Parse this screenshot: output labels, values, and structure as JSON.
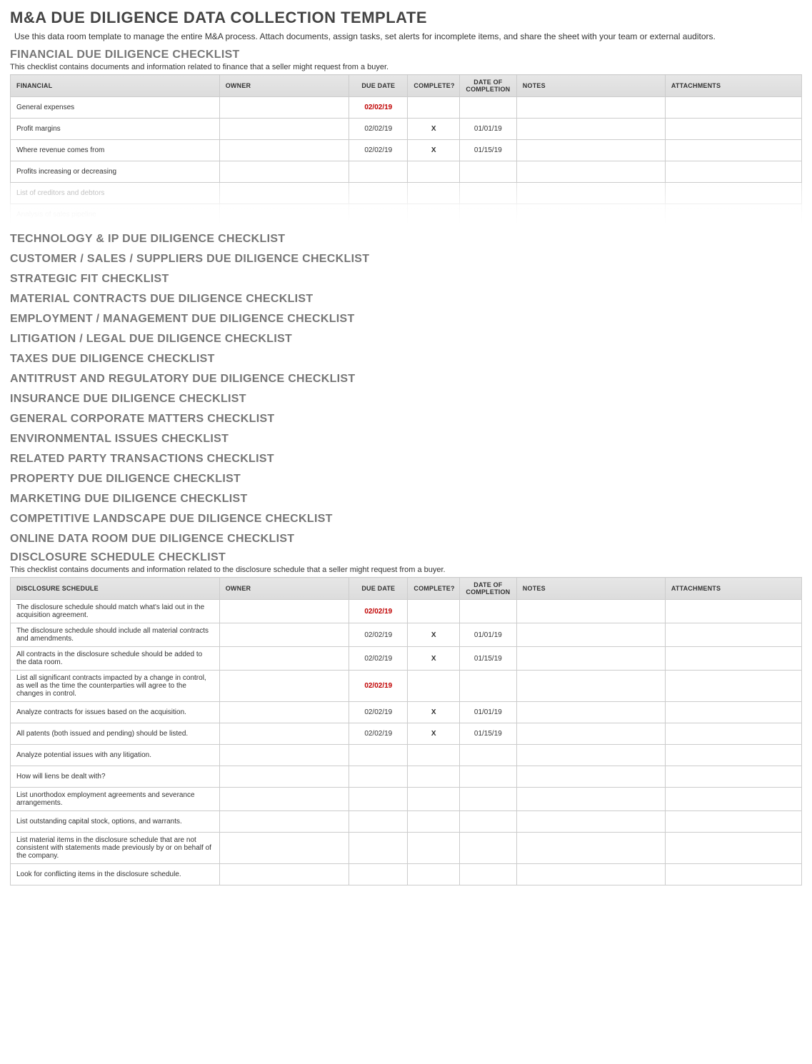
{
  "title": "M&A DUE DILIGENCE DATA COLLECTION TEMPLATE",
  "intro": "Use this data room template to manage the entire M&A process. Attach documents, assign tasks, set alerts for incomplete items, and share the sheet with your team or external auditors.",
  "financial": {
    "heading": "FINANCIAL DUE DILIGENCE CHECKLIST",
    "desc": "This checklist contains documents and information related to finance that a seller might request from a buyer.",
    "col_header": "FINANCIAL",
    "rows": [
      {
        "item": "General expenses",
        "owner": "",
        "due": "02/02/19",
        "due_overdue": true,
        "complete": "",
        "completion": "",
        "notes": "",
        "attach": ""
      },
      {
        "item": "Profit margins",
        "owner": "",
        "due": "02/02/19",
        "due_overdue": false,
        "complete": "X",
        "completion": "01/01/19",
        "notes": "",
        "attach": ""
      },
      {
        "item": "Where revenue comes from",
        "owner": "",
        "due": "02/02/19",
        "due_overdue": false,
        "complete": "X",
        "completion": "01/15/19",
        "notes": "",
        "attach": ""
      },
      {
        "item": "Profits increasing or decreasing",
        "owner": "",
        "due": "",
        "due_overdue": false,
        "complete": "",
        "completion": "",
        "notes": "",
        "attach": ""
      },
      {
        "item": "List of creditors and debtors",
        "owner": "",
        "due": "",
        "due_overdue": false,
        "complete": "",
        "completion": "",
        "notes": "",
        "attach": "",
        "fade": true
      },
      {
        "item": "Analysis of sales pipeline",
        "owner": "",
        "due": "",
        "due_overdue": false,
        "complete": "",
        "completion": "",
        "notes": "",
        "attach": "",
        "fade2": true
      }
    ]
  },
  "columns": {
    "owner": "OWNER",
    "due": "DUE DATE",
    "complete": "COMPLETE?",
    "completion": "DATE OF COMPLETION",
    "notes": "NOTES",
    "attach": "ATTACHMENTS"
  },
  "middle_checklists": [
    "TECHNOLOGY & IP DUE DILIGENCE CHECKLIST",
    "CUSTOMER / SALES / SUPPLIERS DUE DILIGENCE CHECKLIST",
    "STRATEGIC FIT CHECKLIST",
    "MATERIAL CONTRACTS DUE DILIGENCE CHECKLIST",
    "EMPLOYMENT / MANAGEMENT DUE DILIGENCE CHECKLIST",
    "LITIGATION / LEGAL DUE DILIGENCE CHECKLIST",
    "TAXES DUE DILIGENCE CHECKLIST",
    "ANTITRUST AND REGULATORY DUE DILIGENCE CHECKLIST",
    "INSURANCE DUE DILIGENCE CHECKLIST",
    "GENERAL CORPORATE MATTERS CHECKLIST",
    "ENVIRONMENTAL ISSUES CHECKLIST",
    "RELATED PARTY TRANSACTIONS CHECKLIST",
    "PROPERTY DUE DILIGENCE CHECKLIST",
    "MARKETING DUE DILIGENCE CHECKLIST",
    "COMPETITIVE LANDSCAPE DUE DILIGENCE CHECKLIST",
    "ONLINE DATA ROOM DUE DILIGENCE CHECKLIST"
  ],
  "disclosure": {
    "heading": "DISCLOSURE SCHEDULE CHECKLIST",
    "desc": "This checklist contains documents and information related to the disclosure schedule that a seller might request from a buyer.",
    "col_header": "DISCLOSURE SCHEDULE",
    "rows": [
      {
        "item": "The disclosure schedule should match what's laid out in the acquisition agreement.",
        "owner": "",
        "due": "02/02/19",
        "due_overdue": true,
        "complete": "",
        "completion": "",
        "notes": "",
        "attach": ""
      },
      {
        "item": "The disclosure schedule should include all material contracts and amendments.",
        "owner": "",
        "due": "02/02/19",
        "due_overdue": false,
        "complete": "X",
        "completion": "01/01/19",
        "notes": "",
        "attach": ""
      },
      {
        "item": "All contracts in the disclosure schedule should be added to the data room.",
        "owner": "",
        "due": "02/02/19",
        "due_overdue": false,
        "complete": "X",
        "completion": "01/15/19",
        "notes": "",
        "attach": ""
      },
      {
        "item": "List all significant contracts impacted by a change in control, as well as the time the counterparties will agree to the changes in control.",
        "owner": "",
        "due": "02/02/19",
        "due_overdue": true,
        "complete": "",
        "completion": "",
        "notes": "",
        "attach": ""
      },
      {
        "item": "Analyze contracts for issues based on the acquisition.",
        "owner": "",
        "due": "02/02/19",
        "due_overdue": false,
        "complete": "X",
        "completion": "01/01/19",
        "notes": "",
        "attach": ""
      },
      {
        "item": "All patents (both issued and pending) should be listed.",
        "owner": "",
        "due": "02/02/19",
        "due_overdue": false,
        "complete": "X",
        "completion": "01/15/19",
        "notes": "",
        "attach": ""
      },
      {
        "item": "Analyze potential issues with any litigation.",
        "owner": "",
        "due": "",
        "due_overdue": false,
        "complete": "",
        "completion": "",
        "notes": "",
        "attach": ""
      },
      {
        "item": "How will liens be dealt with?",
        "owner": "",
        "due": "",
        "due_overdue": false,
        "complete": "",
        "completion": "",
        "notes": "",
        "attach": ""
      },
      {
        "item": "List unorthodox employment agreements and severance arrangements.",
        "owner": "",
        "due": "",
        "due_overdue": false,
        "complete": "",
        "completion": "",
        "notes": "",
        "attach": ""
      },
      {
        "item": "List outstanding capital stock, options, and warrants.",
        "owner": "",
        "due": "",
        "due_overdue": false,
        "complete": "",
        "completion": "",
        "notes": "",
        "attach": ""
      },
      {
        "item": "List material items in the disclosure schedule that are not consistent with statements made previously by or on behalf of the company.",
        "owner": "",
        "due": "",
        "due_overdue": false,
        "complete": "",
        "completion": "",
        "notes": "",
        "attach": ""
      },
      {
        "item": "Look for conflicting items in the disclosure schedule.",
        "owner": "",
        "due": "",
        "due_overdue": false,
        "complete": "",
        "completion": "",
        "notes": "",
        "attach": ""
      }
    ]
  }
}
